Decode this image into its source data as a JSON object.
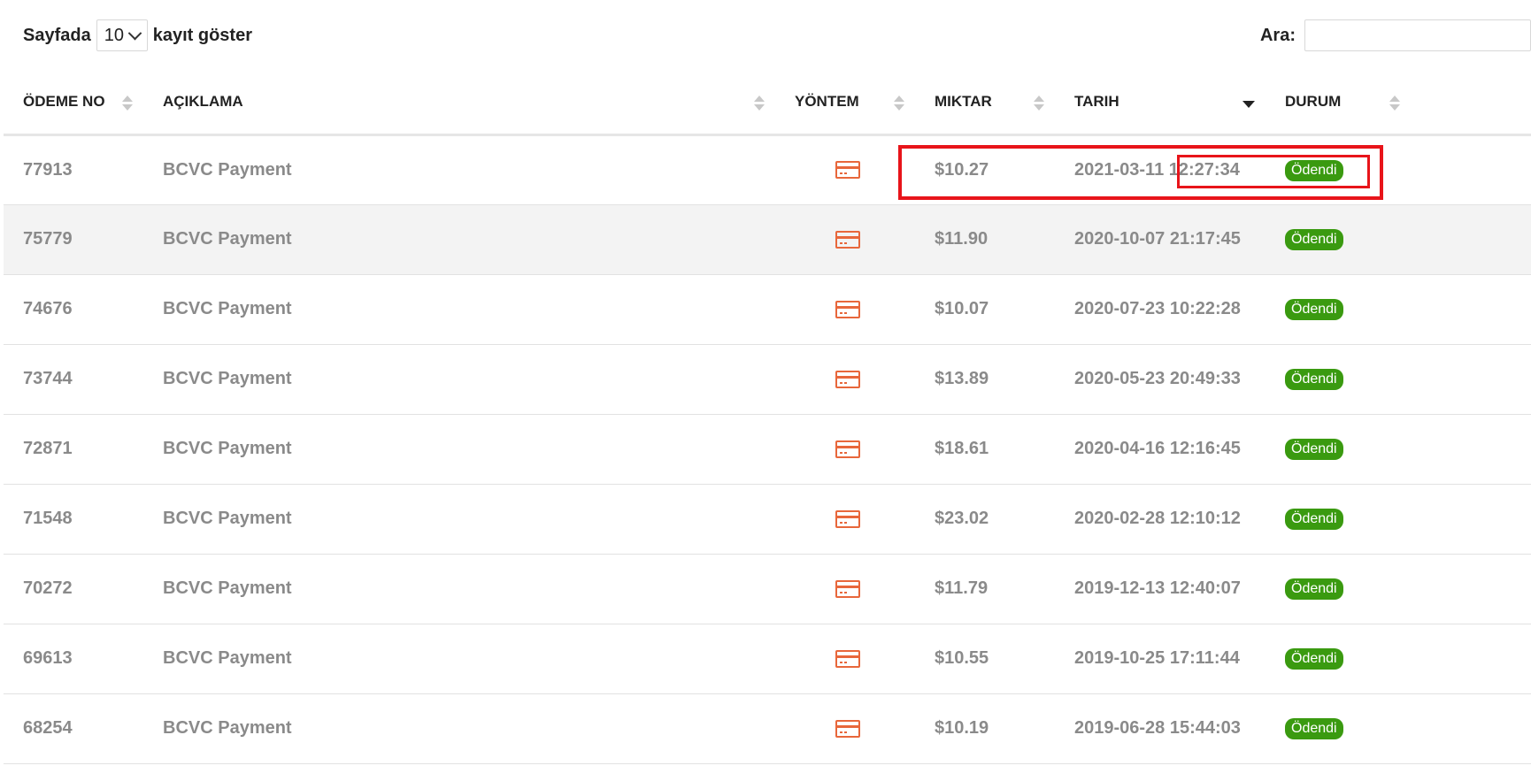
{
  "controls": {
    "length_prefix": "Sayfada",
    "length_value": "10",
    "length_suffix": "kayıt göster",
    "search_label": "Ara:",
    "search_value": ""
  },
  "table": {
    "headers": [
      "ÖDEME NO",
      "AÇIKLAMA",
      "YÖNTEM",
      "MIKTAR",
      "TARIH",
      "DURUM"
    ],
    "rows": [
      {
        "id": "77913",
        "desc": "BCVC Payment",
        "method": "card-icon",
        "amount": "$10.27",
        "date": "2021-03-11 12:27:34",
        "status": "Ödendi"
      },
      {
        "id": "75779",
        "desc": "BCVC Payment",
        "method": "card-icon",
        "amount": "$11.90",
        "date": "2020-10-07 21:17:45",
        "status": "Ödendi"
      },
      {
        "id": "74676",
        "desc": "BCVC Payment",
        "method": "card-icon",
        "amount": "$10.07",
        "date": "2020-07-23 10:22:28",
        "status": "Ödendi"
      },
      {
        "id": "73744",
        "desc": "BCVC Payment",
        "method": "card-icon",
        "amount": "$13.89",
        "date": "2020-05-23 20:49:33",
        "status": "Ödendi"
      },
      {
        "id": "72871",
        "desc": "BCVC Payment",
        "method": "card-icon",
        "amount": "$18.61",
        "date": "2020-04-16 12:16:45",
        "status": "Ödendi"
      },
      {
        "id": "71548",
        "desc": "BCVC Payment",
        "method": "card-icon",
        "amount": "$23.02",
        "date": "2020-02-28 12:10:12",
        "status": "Ödendi"
      },
      {
        "id": "70272",
        "desc": "BCVC Payment",
        "method": "card-icon",
        "amount": "$11.79",
        "date": "2019-12-13 12:40:07",
        "status": "Ödendi"
      },
      {
        "id": "69613",
        "desc": "BCVC Payment",
        "method": "card-icon",
        "amount": "$10.55",
        "date": "2019-10-25 17:11:44",
        "status": "Ödendi"
      },
      {
        "id": "68254",
        "desc": "BCVC Payment",
        "method": "card-icon",
        "amount": "$10.19",
        "date": "2019-06-28 15:44:03",
        "status": "Ödendi"
      }
    ]
  },
  "colors": {
    "amount": "#3a9a10",
    "badge": "#3a9a10",
    "card_icon": "#e8673b",
    "highlight": "#e8141a"
  }
}
